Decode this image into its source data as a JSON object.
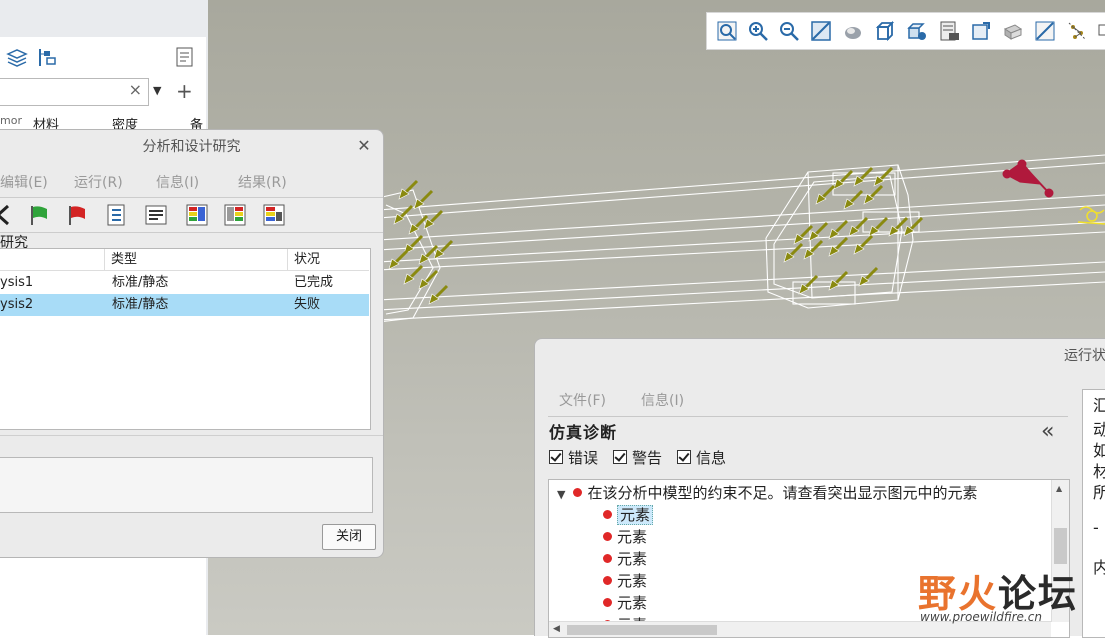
{
  "left_panel": {
    "columns": [
      "mor",
      "材料",
      "密度",
      "备"
    ]
  },
  "study_dialog": {
    "title": "分析和设计研究",
    "menu": [
      "编辑(E)",
      "运行(R)",
      "信息(I)",
      "结果(R)"
    ],
    "section_label": "研究",
    "table": {
      "headers": [
        "",
        "类型",
        "状况"
      ],
      "rows": [
        {
          "name": "ysis1",
          "type": "标准/静态",
          "status": "已完成",
          "selected": false
        },
        {
          "name": "ysis2",
          "type": "标准/静态",
          "status": "失败",
          "selected": true
        }
      ]
    },
    "close_label": "关闭"
  },
  "run_status": {
    "title": "运行状",
    "menu": [
      "文件(F)",
      "信息(I)"
    ],
    "diag_title": "仿真诊断",
    "collapse_glyph": "«",
    "filters": [
      "错误",
      "警告",
      "信息"
    ],
    "message": "在该分析中模型的约束不足。请查看突出显示图元中的元素",
    "elements": [
      "元素",
      "元素",
      "元素",
      "元素",
      "元素",
      "元素"
    ],
    "side_text": [
      "汇",
      "动",
      "如",
      "材",
      "所",
      "-",
      "内"
    ]
  },
  "watermark": {
    "brand_a": "野火",
    "brand_b": "论坛",
    "url": "www.proewildfire.cn"
  },
  "colors": {
    "accent_select": "#a8dcf7",
    "error_dot": "#e02828",
    "load_arrow": "#8a8a10",
    "brand_orange": "#e9732e"
  },
  "icons": [
    "layers-icon",
    "tree-filter-icon",
    "settings-sheet-icon",
    "zoom-fit-icon",
    "zoom-in-icon",
    "zoom-out-icon",
    "repaint-icon",
    "shading-icon",
    "view-cube-icon",
    "saved-views-icon",
    "display-style-icon",
    "camera-icon",
    "annotation-icon",
    "datum-icon",
    "spin-center-icon",
    "green-flag-icon",
    "red-flag-icon",
    "checklist-icon",
    "info-icon",
    "results-icon"
  ]
}
